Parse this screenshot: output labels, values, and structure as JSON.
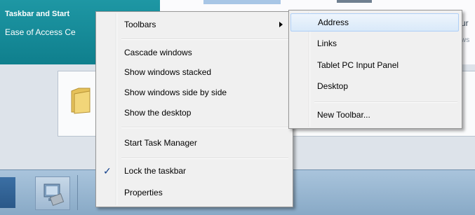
{
  "background": {
    "tile_line1": "Taskbar and Start",
    "tile_line2": "Ease of Access Ce",
    "right_text": "ur",
    "right_text2": "ws"
  },
  "context_menu": {
    "items": [
      {
        "label": "Toolbars",
        "has_submenu": true
      },
      {
        "label": "Cascade windows"
      },
      {
        "label": "Show windows stacked"
      },
      {
        "label": "Show windows side by side"
      },
      {
        "label": "Show the desktop"
      },
      {
        "label": "Start Task Manager"
      },
      {
        "label": "Lock the taskbar",
        "checked": true,
        "check_glyph": "✓"
      },
      {
        "label": "Properties"
      }
    ]
  },
  "toolbars_submenu": {
    "items": [
      {
        "label": "Address"
      },
      {
        "label": "Links"
      },
      {
        "label": "Tablet PC Input Panel"
      },
      {
        "label": "Desktop"
      },
      {
        "label": "New Toolbar..."
      }
    ]
  },
  "colors": {
    "tile": "#1e97a4",
    "menu_bg": "#f0f0f0",
    "highlight": "#d9e9f9",
    "taskbar": "#a9c4dc"
  }
}
